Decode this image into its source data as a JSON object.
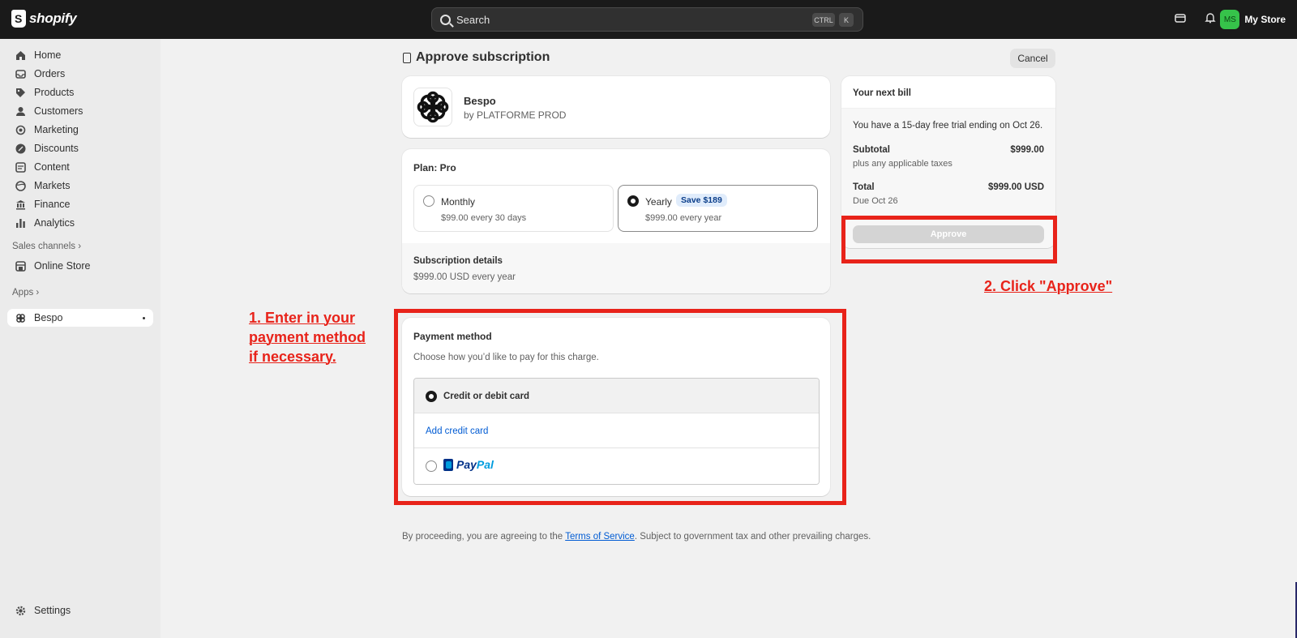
{
  "topbar": {
    "logo_text": "shopify",
    "search_placeholder": "Search",
    "shortcut_ctrl": "CTRL",
    "shortcut_key": "K",
    "avatar_initials": "MS",
    "store_name": "My Store"
  },
  "sidebar": {
    "items": [
      {
        "label": "Home",
        "icon": "home-icon"
      },
      {
        "label": "Orders",
        "icon": "orders-icon"
      },
      {
        "label": "Products",
        "icon": "tag-icon"
      },
      {
        "label": "Customers",
        "icon": "person-icon"
      },
      {
        "label": "Marketing",
        "icon": "target-icon"
      },
      {
        "label": "Discounts",
        "icon": "discount-icon"
      },
      {
        "label": "Content",
        "icon": "content-icon"
      },
      {
        "label": "Markets",
        "icon": "globe-icon"
      },
      {
        "label": "Finance",
        "icon": "bank-icon"
      },
      {
        "label": "Analytics",
        "icon": "bar-chart-icon"
      }
    ],
    "sales_channels_label": "Sales channels",
    "online_store_label": "Online Store",
    "apps_label": "Apps",
    "active_app_label": "Bespo",
    "settings_label": "Settings"
  },
  "page": {
    "title": "Approve subscription",
    "cancel_label": "Cancel"
  },
  "app_card": {
    "name": "Bespo",
    "by": "by PLATFORME PROD"
  },
  "plan": {
    "label": "Plan: Pro",
    "options": [
      {
        "title": "Monthly",
        "price": "$99.00 every 30 days",
        "selected": false
      },
      {
        "title": "Yearly",
        "price": "$999.00 every year",
        "badge": "Save $189",
        "selected": true
      }
    ],
    "details_title": "Subscription details",
    "details_value": "$999.00 USD every year"
  },
  "bill": {
    "title": "Your next bill",
    "trial_text": "You have a 15-day free trial ending on Oct 26.",
    "subtotal_label": "Subtotal",
    "subtotal_value": "$999.00",
    "taxes_note": "plus any applicable taxes",
    "total_label": "Total",
    "total_value": "$999.00 USD",
    "due": "Due Oct 26",
    "approve_label": "Approve"
  },
  "payment": {
    "title": "Payment method",
    "description": "Choose how you’d like to pay for this charge.",
    "card_option": "Credit or debit card",
    "add_card_link": "Add credit card",
    "paypal_part1": "Pay",
    "paypal_part2": "Pal"
  },
  "footer": {
    "prefix": "By proceeding, you are agreeing to the ",
    "link": "Terms of Service",
    "suffix": ". Subject to government tax and other prevailing charges."
  },
  "annotations": {
    "step1_line1": "1. Enter in your",
    "step1_line2": "payment method",
    "step1_line3": "if necessary.",
    "step2": "2. Click \"Approve\"",
    "highlight_color": "#e8231a"
  },
  "colors": {
    "topbar_bg": "#1a1a1a",
    "link": "#005bd3",
    "avatar_bg": "#36c34a",
    "approve_disabled": "#d4d4d4"
  }
}
